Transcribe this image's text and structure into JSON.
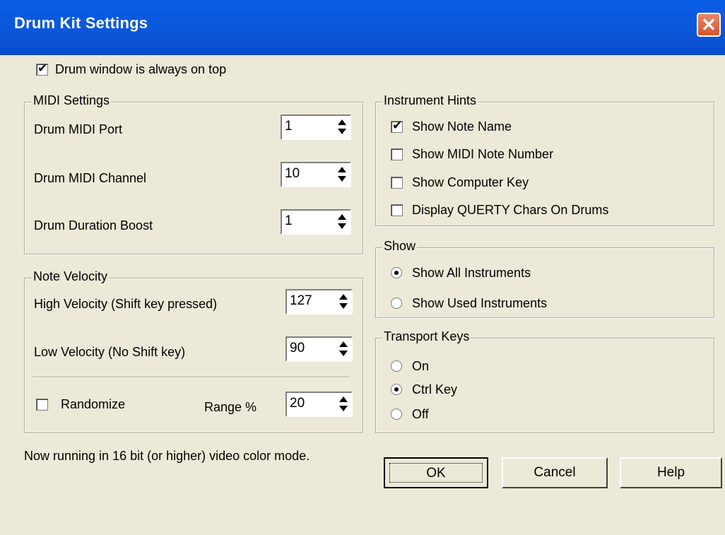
{
  "window": {
    "title": "Drum Kit Settings"
  },
  "always_on_top": {
    "label": "Drum window is always on top",
    "checked": true
  },
  "midi_settings": {
    "title": "MIDI Settings",
    "port": {
      "label": "Drum MIDI Port",
      "value": "1"
    },
    "channel": {
      "label": "Drum MIDI Channel",
      "value": "10"
    },
    "boost": {
      "label": "Drum Duration Boost",
      "value": "1"
    }
  },
  "note_velocity": {
    "title": "Note Velocity",
    "high": {
      "label": "High Velocity (Shift key pressed)",
      "value": "127"
    },
    "low": {
      "label": "Low Velocity (No Shift key)",
      "value": "90"
    },
    "randomize": {
      "label": "Randomize",
      "checked": false
    },
    "range": {
      "label": "Range %",
      "value": "20"
    }
  },
  "instrument_hints": {
    "title": "Instrument Hints",
    "items": [
      {
        "label": "Show Note Name",
        "checked": true
      },
      {
        "label": "Show MIDI Note Number",
        "checked": false
      },
      {
        "label": "Show Computer Key",
        "checked": false
      },
      {
        "label": "Display QUERTY Chars On Drums",
        "checked": false
      }
    ]
  },
  "show": {
    "title": "Show",
    "options": [
      {
        "label": "Show All Instruments",
        "selected": true
      },
      {
        "label": "Show Used Instruments",
        "selected": false
      }
    ]
  },
  "transport_keys": {
    "title": "Transport Keys",
    "options": [
      {
        "label": "On",
        "selected": false
      },
      {
        "label": "Ctrl Key",
        "selected": true
      },
      {
        "label": "Off",
        "selected": false
      }
    ]
  },
  "status_text": "Now running in 16 bit (or higher) video color mode.",
  "buttons": {
    "ok": "OK",
    "cancel": "Cancel",
    "help": "Help"
  }
}
